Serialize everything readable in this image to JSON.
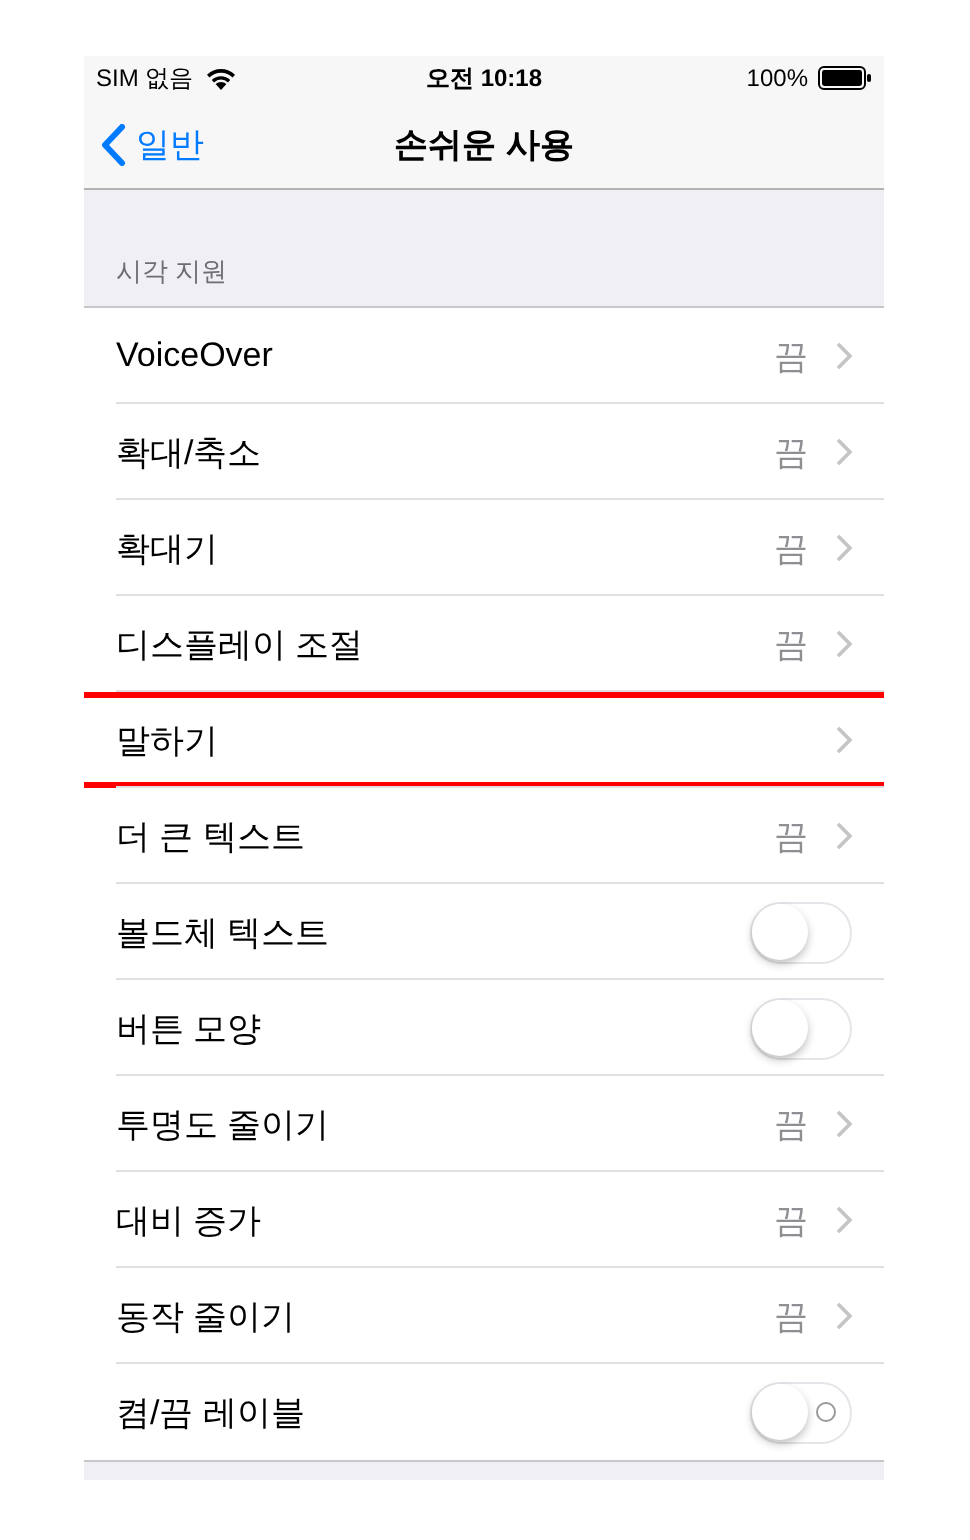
{
  "status_bar": {
    "carrier": "SIM 없음",
    "time": "오전 10:18",
    "battery": "100%"
  },
  "nav": {
    "back": "일반",
    "title": "손쉬운 사용"
  },
  "section": {
    "header": "시각 지원",
    "items": [
      {
        "kind": "link",
        "label": "VoiceOver",
        "value": "끔",
        "highlighted": false
      },
      {
        "kind": "link",
        "label": "확대/축소",
        "value": "끔",
        "highlighted": false
      },
      {
        "kind": "link",
        "label": "확대기",
        "value": "끔",
        "highlighted": false
      },
      {
        "kind": "link",
        "label": "디스플레이 조절",
        "value": "끔",
        "highlighted": false
      },
      {
        "kind": "link",
        "label": "말하기",
        "highlighted": true
      },
      {
        "kind": "link",
        "label": "더 큰 텍스트",
        "value": "끔",
        "highlighted": false
      },
      {
        "kind": "toggle",
        "label": "볼드체 텍스트",
        "on": false,
        "labels": false,
        "highlighted": false
      },
      {
        "kind": "toggle",
        "label": "버튼 모양",
        "on": false,
        "labels": false,
        "highlighted": false
      },
      {
        "kind": "link",
        "label": "투명도 줄이기",
        "value": "끔",
        "highlighted": false
      },
      {
        "kind": "link",
        "label": "대비 증가",
        "value": "끔",
        "highlighted": false
      },
      {
        "kind": "link",
        "label": "동작 줄이기",
        "value": "끔",
        "highlighted": false
      },
      {
        "kind": "toggle",
        "label": "켬/끔 레이블",
        "on": false,
        "labels": true,
        "highlighted": false
      }
    ]
  }
}
